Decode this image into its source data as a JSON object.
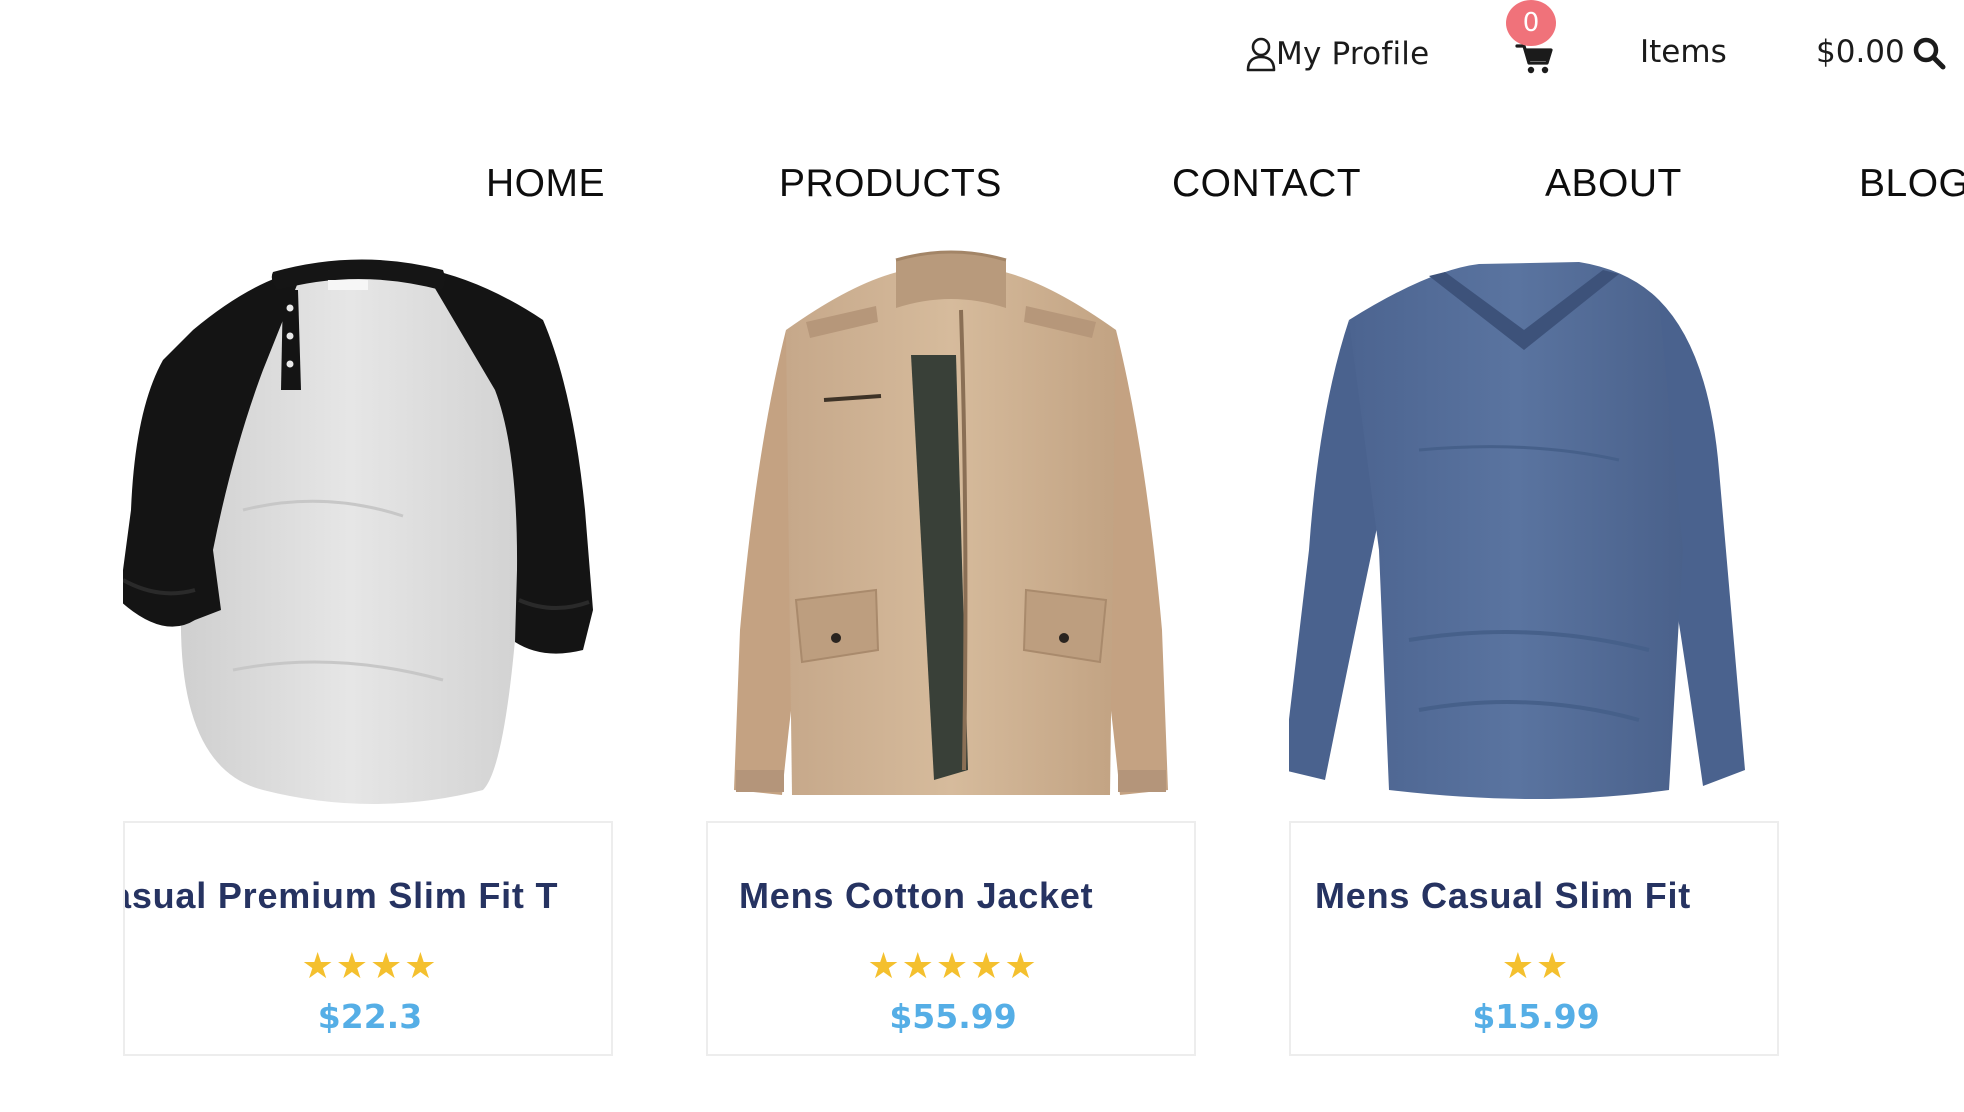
{
  "header": {
    "profile_label": "My Profile",
    "cart_count": "0",
    "items_label": "Items",
    "cart_total": "$0.00"
  },
  "nav": {
    "items": [
      {
        "label": "HOME"
      },
      {
        "label": "PRODUCTS"
      },
      {
        "label": "CONTACT"
      },
      {
        "label": "ABOUT"
      },
      {
        "label": "BLOG"
      }
    ]
  },
  "products": [
    {
      "title": "asual Premium Slim Fit T",
      "stars": "★★★★",
      "rating": 4,
      "price": "$22.3"
    },
    {
      "title": "Mens Cotton Jacket",
      "stars": "★★★★★",
      "rating": 5,
      "price": "$55.99"
    },
    {
      "title": "Mens Casual Slim Fit",
      "stars": "★★",
      "rating": 2,
      "price": "$15.99"
    }
  ],
  "colors": {
    "badge": "#f0727a",
    "title": "#263361",
    "star": "#f4c02e",
    "price": "#55aee6"
  }
}
